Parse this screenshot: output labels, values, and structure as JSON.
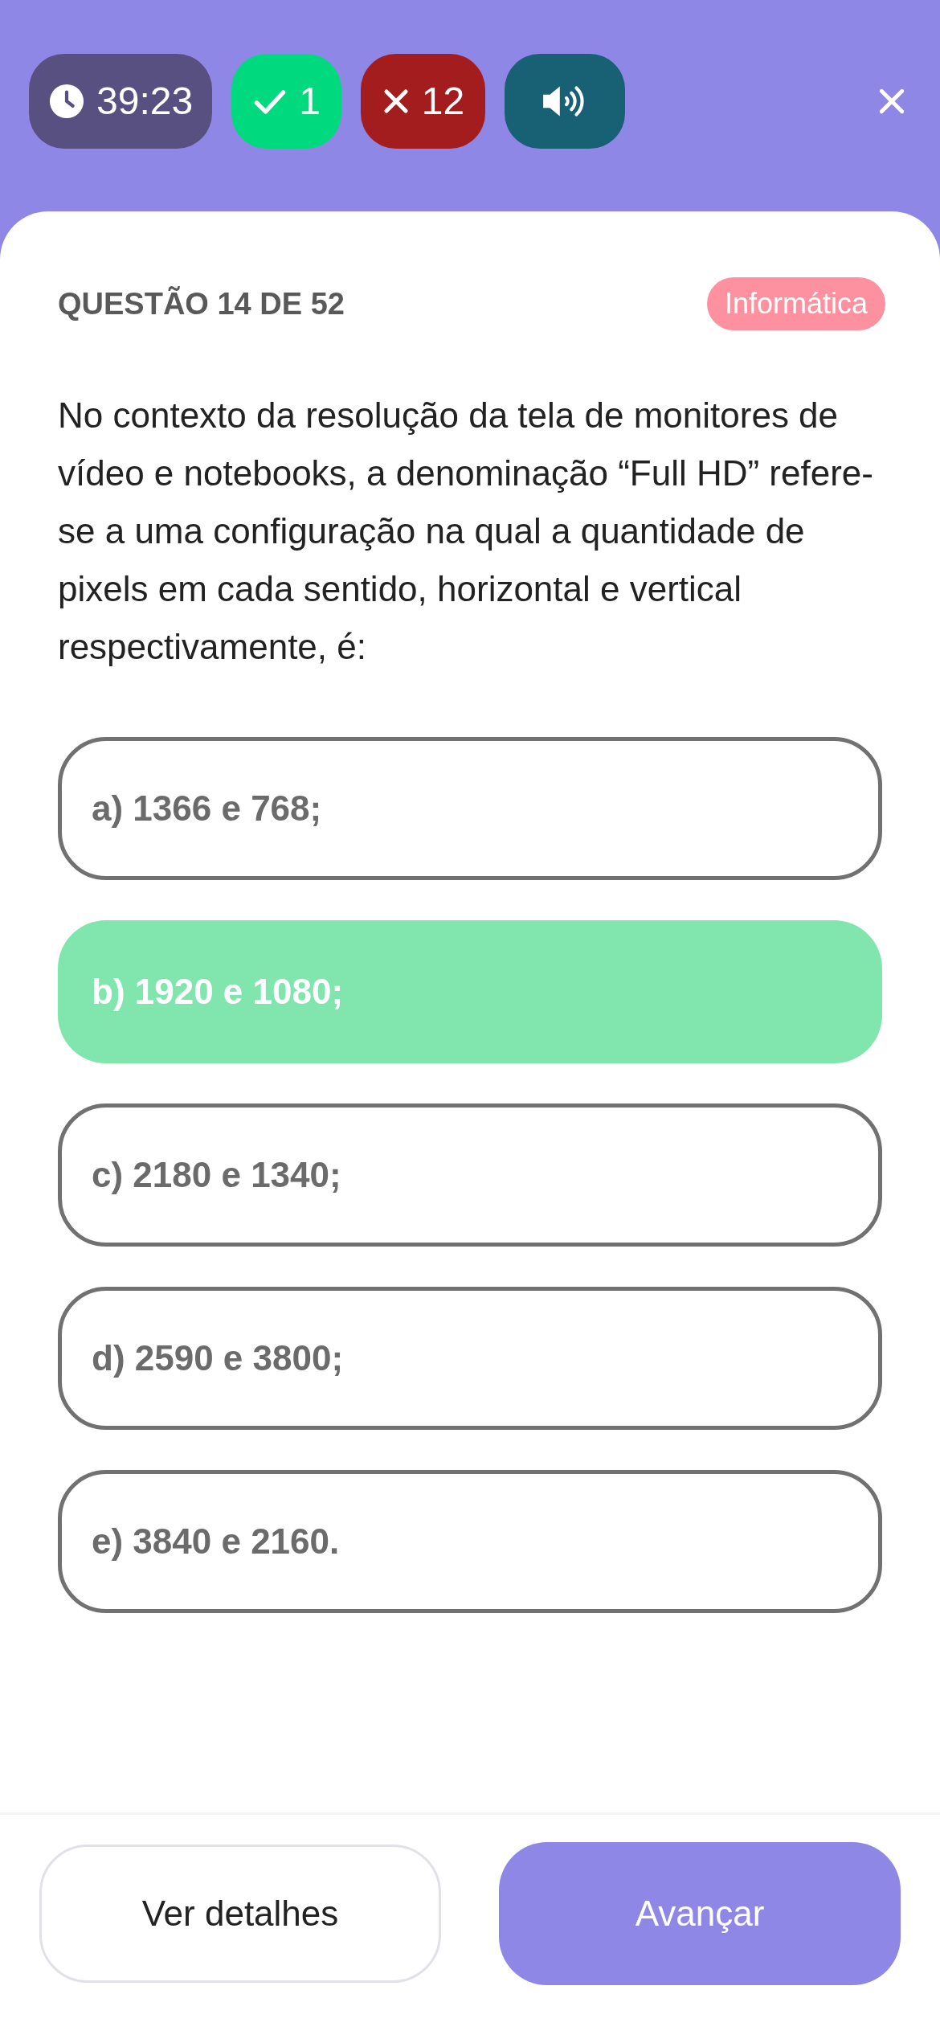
{
  "status": {
    "timer": "39:23",
    "correct": "1",
    "wrong": "12"
  },
  "question": {
    "counter": "QUESTÃO 14 DE 52",
    "subject": "Informática",
    "text": "No contexto da resolução da tela de monitores de vídeo e notebooks, a denominação “Full HD” refere-se a uma configuração na qual a quantidade de pixels em cada sentido, horizontal e vertical respectivamente, é:"
  },
  "options": [
    {
      "label": "a) 1366 e 768;",
      "selected": false
    },
    {
      "label": "b) 1920 e 1080;",
      "selected": true
    },
    {
      "label": "c) 2180 e 1340;",
      "selected": false
    },
    {
      "label": "d) 2590 e 3800;",
      "selected": false
    },
    {
      "label": "e) 3840 e 2160.",
      "selected": false
    }
  ],
  "buttons": {
    "details": "Ver detalhes",
    "next": "Avançar"
  }
}
